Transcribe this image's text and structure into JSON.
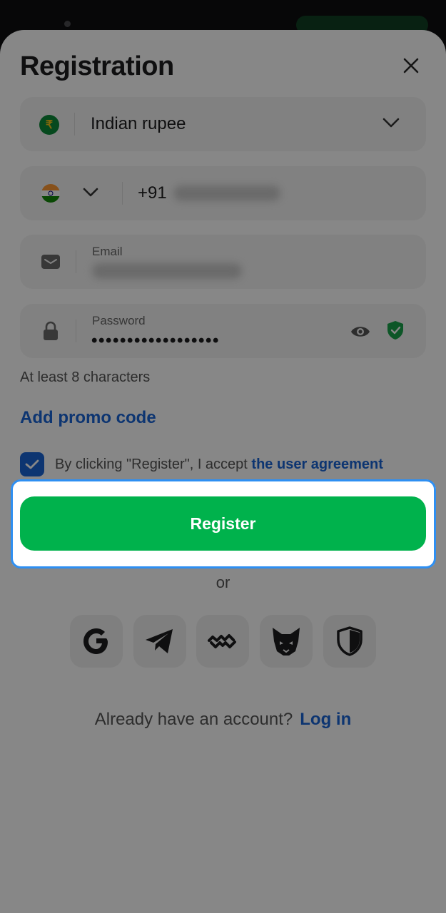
{
  "header": {
    "title": "Registration"
  },
  "currency": {
    "value": "Indian rupee",
    "symbol": "₹"
  },
  "phone": {
    "country_code": "+91"
  },
  "email": {
    "label": "Email"
  },
  "password": {
    "label": "Password",
    "masked_value": "••••••••••••••••••",
    "hint": "At least 8 characters"
  },
  "promo": {
    "label": "Add promo code"
  },
  "agreement": {
    "checked": true,
    "text": "By clicking \"Register\", I accept ",
    "link_text": "the user agreement"
  },
  "register": {
    "label": "Register"
  },
  "separator": {
    "label": "or"
  },
  "social_logins": [
    "google-icon",
    "telegram-icon",
    "walletconnect-icon",
    "metamask-icon",
    "shield-icon"
  ],
  "footer": {
    "question": "Already have an account?",
    "login_label": "Log in"
  },
  "colors": {
    "accent_blue": "#1a64d6",
    "register_green": "#00b24c",
    "highlight_border": "#2e8ff2",
    "shield_green": "#1aa34a"
  }
}
